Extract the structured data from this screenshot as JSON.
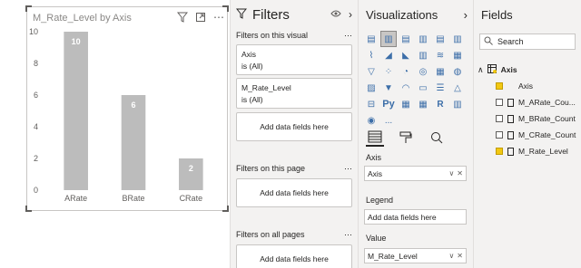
{
  "visual": {
    "title": "M_Rate_Level by Axis",
    "toolbar_icons": [
      "filter-icon",
      "focus-mode-icon",
      "more-options-icon"
    ]
  },
  "chart_data": {
    "type": "bar",
    "categories": [
      "ARate",
      "BRate",
      "CRate"
    ],
    "values": [
      10,
      6,
      2
    ],
    "y_ticks": [
      0,
      2,
      4,
      6,
      8,
      10
    ],
    "ylim": [
      0,
      10
    ],
    "bar_color": "#bcbcbc",
    "data_labels": [
      "10",
      "6",
      "2"
    ]
  },
  "filters": {
    "title": "Filters",
    "on_visual_label": "Filters on this visual",
    "cards": [
      {
        "field": "Axis",
        "state": "is (All)"
      },
      {
        "field": "M_Rate_Level",
        "state": "is (All)"
      }
    ],
    "add_label": "Add data fields here",
    "on_page_label": "Filters on this page",
    "on_all_pages_label": "Filters on all pages"
  },
  "visualizations": {
    "title": "Visualizations",
    "more": "...",
    "axis_label": "Axis",
    "axis_value": "Axis",
    "legend_label": "Legend",
    "legend_placeholder": "Add data fields here",
    "value_label": "Value",
    "value_value": "M_Rate_Level"
  },
  "fields": {
    "title": "Fields",
    "search_placeholder": "Search",
    "table_name": "Axis",
    "items": [
      {
        "label": "Axis",
        "checked": true,
        "kind": "field"
      },
      {
        "label": "M_ARate_Cou...",
        "checked": false,
        "kind": "calc"
      },
      {
        "label": "M_BRate_Count",
        "checked": false,
        "kind": "calc"
      },
      {
        "label": "M_CRate_Count",
        "checked": false,
        "kind": "calc"
      },
      {
        "label": "M_Rate_Level",
        "checked": true,
        "kind": "calc"
      }
    ]
  },
  "colors": {
    "accent_yellow": "#f2c811",
    "pane_bg": "#f3f2f1"
  }
}
